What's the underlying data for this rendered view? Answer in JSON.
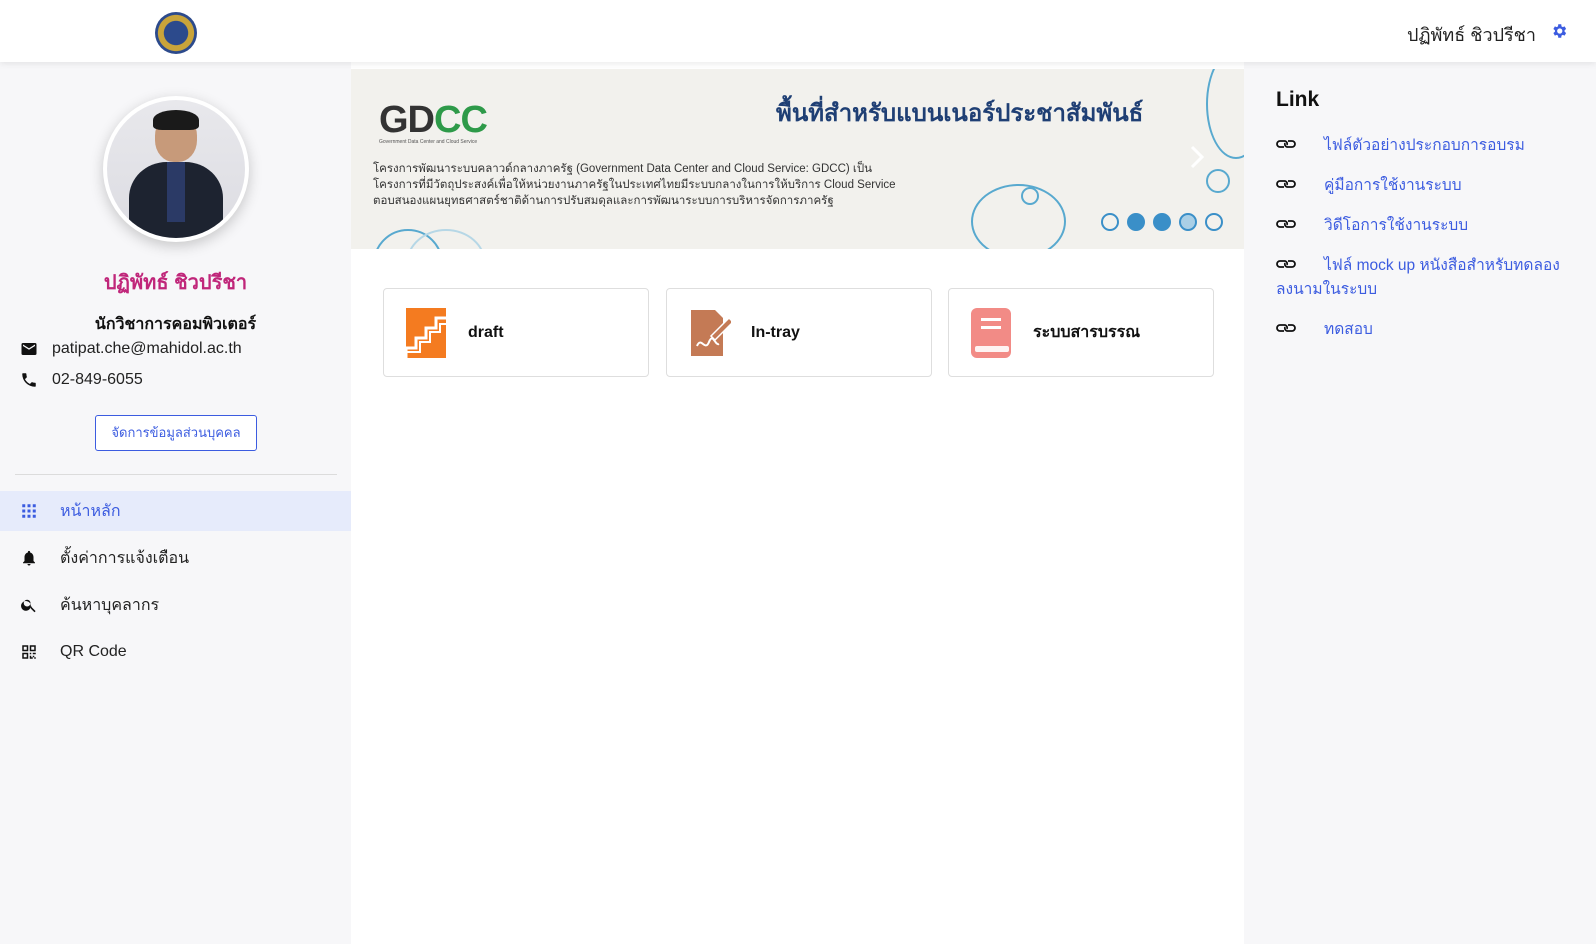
{
  "header": {
    "user_name": "ปฏิพัทธ์ ชิวปรีชา"
  },
  "profile": {
    "name": "ปฏิพัทธ์ ชิวปรีชา",
    "role": "นักวิชาการคอมพิวเตอร์",
    "email": "patipat.che@mahidol.ac.th",
    "phone": "02-849-6055",
    "manage_label": "จัดการข้อมูลส่วนบุคคล"
  },
  "nav": {
    "items": [
      {
        "label": "หน้าหลัก",
        "icon": "grid-icon",
        "active": true
      },
      {
        "label": "ตั้งค่าการแจ้งเตือน",
        "icon": "bell-icon",
        "active": false
      },
      {
        "label": "ค้นหาบุคลากร",
        "icon": "search-icon",
        "active": false
      },
      {
        "label": "QR Code",
        "icon": "qr-code-icon",
        "active": false
      }
    ]
  },
  "banner": {
    "logo_text": "GDCC",
    "logo_subtext": "Government Data Center and Cloud Service",
    "title": "พื้นที่สำหรับแบนเนอร์ประชาสัมพันธ์",
    "line1": "โครงการพัฒนาระบบคลาวด์กลางภาครัฐ (Government Data Center and Cloud Service: GDCC) เป็น",
    "line2": "โครงการที่มีวัตถุประสงค์เพื่อให้หน่วยงานภาครัฐในประเทศไทยมีระบบกลางในการให้บริการ Cloud Service",
    "line3": "ตอบสนองแผนยุทธศาสตร์ชาติด้านการปรับสมดุลและการพัฒนาระบบการบริหารจัดการภาครัฐ",
    "slides": 5,
    "filled_dots": [
      1,
      2
    ]
  },
  "cards": [
    {
      "label": "draft",
      "icon": "draft-stairs-icon",
      "color": "#f47b20"
    },
    {
      "label": "In-tray",
      "icon": "signature-document-icon",
      "color": "#c47a55"
    },
    {
      "label": "ระบบสารบรรณ",
      "icon": "book-icon",
      "color": "#f28b86"
    }
  ],
  "links": {
    "title": "Link",
    "items": [
      "ไฟล์ตัวอย่างประกอบการอบรม",
      "คู่มือการใช้งานระบบ",
      "วิดีโอการใช้งานระบบ",
      "ไฟล์ mock up หนังสือสำหรับทดลองลงนามในระบบ",
      "ทดสอบ"
    ]
  },
  "colors": {
    "accent": "#3c5ce0",
    "profile_name": "#c0267a",
    "banner_title": "#1f3f74",
    "gdcc_green": "#2e9a49"
  }
}
